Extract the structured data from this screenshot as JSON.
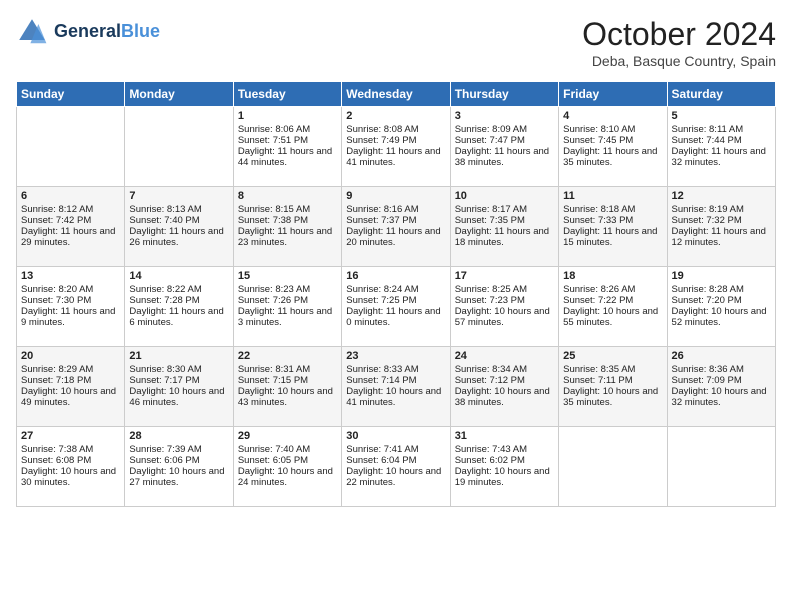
{
  "header": {
    "logo_line1": "General",
    "logo_line2": "Blue",
    "month": "October 2024",
    "location": "Deba, Basque Country, Spain"
  },
  "days_of_week": [
    "Sunday",
    "Monday",
    "Tuesday",
    "Wednesday",
    "Thursday",
    "Friday",
    "Saturday"
  ],
  "weeks": [
    [
      {
        "day": "",
        "content": ""
      },
      {
        "day": "",
        "content": ""
      },
      {
        "day": "1",
        "content": "Sunrise: 8:06 AM\nSunset: 7:51 PM\nDaylight: 11 hours and 44 minutes."
      },
      {
        "day": "2",
        "content": "Sunrise: 8:08 AM\nSunset: 7:49 PM\nDaylight: 11 hours and 41 minutes."
      },
      {
        "day": "3",
        "content": "Sunrise: 8:09 AM\nSunset: 7:47 PM\nDaylight: 11 hours and 38 minutes."
      },
      {
        "day": "4",
        "content": "Sunrise: 8:10 AM\nSunset: 7:45 PM\nDaylight: 11 hours and 35 minutes."
      },
      {
        "day": "5",
        "content": "Sunrise: 8:11 AM\nSunset: 7:44 PM\nDaylight: 11 hours and 32 minutes."
      }
    ],
    [
      {
        "day": "6",
        "content": "Sunrise: 8:12 AM\nSunset: 7:42 PM\nDaylight: 11 hours and 29 minutes."
      },
      {
        "day": "7",
        "content": "Sunrise: 8:13 AM\nSunset: 7:40 PM\nDaylight: 11 hours and 26 minutes."
      },
      {
        "day": "8",
        "content": "Sunrise: 8:15 AM\nSunset: 7:38 PM\nDaylight: 11 hours and 23 minutes."
      },
      {
        "day": "9",
        "content": "Sunrise: 8:16 AM\nSunset: 7:37 PM\nDaylight: 11 hours and 20 minutes."
      },
      {
        "day": "10",
        "content": "Sunrise: 8:17 AM\nSunset: 7:35 PM\nDaylight: 11 hours and 18 minutes."
      },
      {
        "day": "11",
        "content": "Sunrise: 8:18 AM\nSunset: 7:33 PM\nDaylight: 11 hours and 15 minutes."
      },
      {
        "day": "12",
        "content": "Sunrise: 8:19 AM\nSunset: 7:32 PM\nDaylight: 11 hours and 12 minutes."
      }
    ],
    [
      {
        "day": "13",
        "content": "Sunrise: 8:20 AM\nSunset: 7:30 PM\nDaylight: 11 hours and 9 minutes."
      },
      {
        "day": "14",
        "content": "Sunrise: 8:22 AM\nSunset: 7:28 PM\nDaylight: 11 hours and 6 minutes."
      },
      {
        "day": "15",
        "content": "Sunrise: 8:23 AM\nSunset: 7:26 PM\nDaylight: 11 hours and 3 minutes."
      },
      {
        "day": "16",
        "content": "Sunrise: 8:24 AM\nSunset: 7:25 PM\nDaylight: 11 hours and 0 minutes."
      },
      {
        "day": "17",
        "content": "Sunrise: 8:25 AM\nSunset: 7:23 PM\nDaylight: 10 hours and 57 minutes."
      },
      {
        "day": "18",
        "content": "Sunrise: 8:26 AM\nSunset: 7:22 PM\nDaylight: 10 hours and 55 minutes."
      },
      {
        "day": "19",
        "content": "Sunrise: 8:28 AM\nSunset: 7:20 PM\nDaylight: 10 hours and 52 minutes."
      }
    ],
    [
      {
        "day": "20",
        "content": "Sunrise: 8:29 AM\nSunset: 7:18 PM\nDaylight: 10 hours and 49 minutes."
      },
      {
        "day": "21",
        "content": "Sunrise: 8:30 AM\nSunset: 7:17 PM\nDaylight: 10 hours and 46 minutes."
      },
      {
        "day": "22",
        "content": "Sunrise: 8:31 AM\nSunset: 7:15 PM\nDaylight: 10 hours and 43 minutes."
      },
      {
        "day": "23",
        "content": "Sunrise: 8:33 AM\nSunset: 7:14 PM\nDaylight: 10 hours and 41 minutes."
      },
      {
        "day": "24",
        "content": "Sunrise: 8:34 AM\nSunset: 7:12 PM\nDaylight: 10 hours and 38 minutes."
      },
      {
        "day": "25",
        "content": "Sunrise: 8:35 AM\nSunset: 7:11 PM\nDaylight: 10 hours and 35 minutes."
      },
      {
        "day": "26",
        "content": "Sunrise: 8:36 AM\nSunset: 7:09 PM\nDaylight: 10 hours and 32 minutes."
      }
    ],
    [
      {
        "day": "27",
        "content": "Sunrise: 7:38 AM\nSunset: 6:08 PM\nDaylight: 10 hours and 30 minutes."
      },
      {
        "day": "28",
        "content": "Sunrise: 7:39 AM\nSunset: 6:06 PM\nDaylight: 10 hours and 27 minutes."
      },
      {
        "day": "29",
        "content": "Sunrise: 7:40 AM\nSunset: 6:05 PM\nDaylight: 10 hours and 24 minutes."
      },
      {
        "day": "30",
        "content": "Sunrise: 7:41 AM\nSunset: 6:04 PM\nDaylight: 10 hours and 22 minutes."
      },
      {
        "day": "31",
        "content": "Sunrise: 7:43 AM\nSunset: 6:02 PM\nDaylight: 10 hours and 19 minutes."
      },
      {
        "day": "",
        "content": ""
      },
      {
        "day": "",
        "content": ""
      }
    ]
  ]
}
